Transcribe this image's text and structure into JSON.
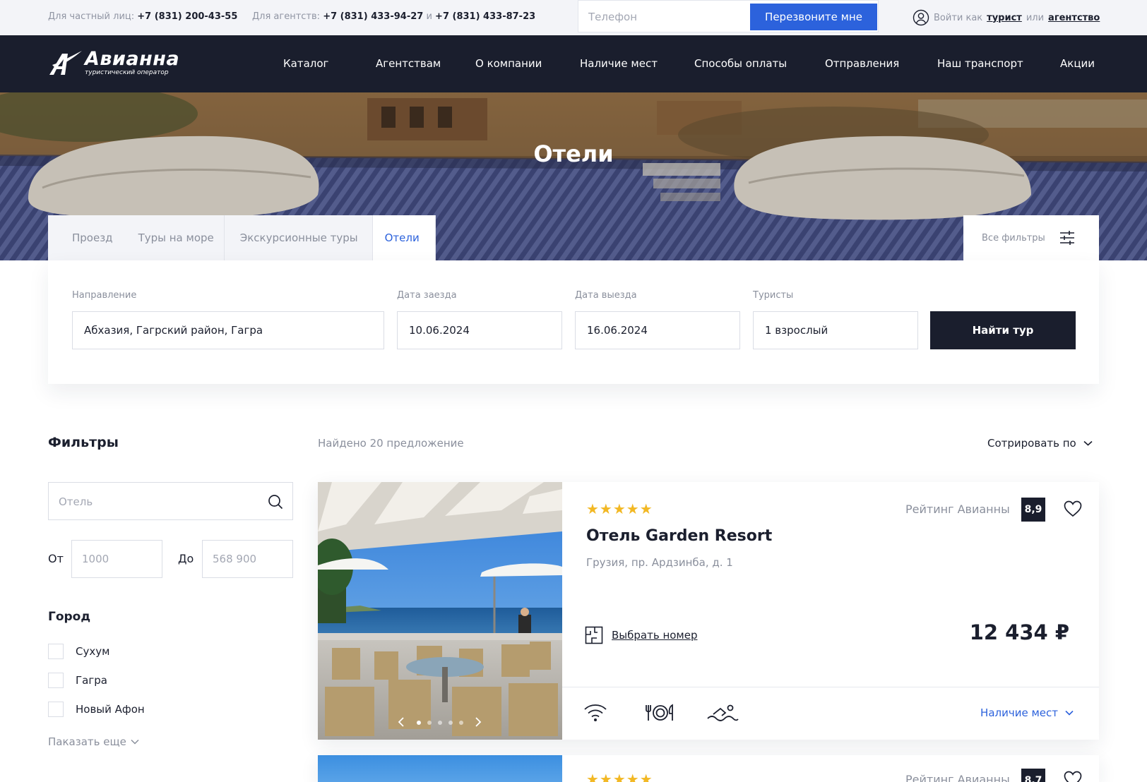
{
  "topbar": {
    "private_label": "Для частный лиц:",
    "private_phone": "+7 (831) 200-43-55",
    "agency_label": "Для агентств:",
    "agency_phone_1": "+7 (831) 433-94-27",
    "agency_and": "и",
    "agency_phone_2": "+7 (831) 433-87-23",
    "phone_placeholder": "Телефон",
    "callback_label": "Перезвоните мне",
    "login_prefix": "Войти как",
    "login_tourist": "турист",
    "login_or": "или",
    "login_agency": "агентство"
  },
  "brand": {
    "name": "Авианна",
    "tagline": "туристический оператор"
  },
  "nav": {
    "items": [
      "Каталог",
      "Агентствам",
      "О компании",
      "Наличие мест",
      "Способы оплаты",
      "Отправления",
      "Наш транспорт",
      "Акции"
    ]
  },
  "hero": {
    "title": "Отели"
  },
  "tabs": {
    "items": [
      "Проезд",
      "Туры на море",
      "Экскурсионные туры",
      "Отели"
    ],
    "active": "Отели",
    "all_filters": "Все фильтры"
  },
  "search": {
    "direction_label": "Направление",
    "direction_value": "Абхазия, Гагрский район, Гагра",
    "checkin_label": "Дата заезда",
    "checkin_value": "10.06.2024",
    "checkout_label": "Дата выезда",
    "checkout_value": "16.06.2024",
    "tourists_label": "Туристы",
    "tourists_value": "1 взрослый",
    "submit_label": "Найти тур"
  },
  "filters": {
    "title": "Фильтры",
    "hotel_placeholder": "Отель",
    "from_label": "От",
    "from_placeholder": "1000",
    "to_label": "До",
    "to_placeholder": "568 900",
    "city_title": "Город",
    "cities": [
      "Сухум",
      "Гагра",
      "Новый Афон"
    ],
    "show_more": "Паказать еще"
  },
  "results": {
    "found_text": "Найдено 20 предложение",
    "sort_label": "Сотрировать по",
    "cards": [
      {
        "stars": "★★★★★",
        "rating_label": "Рейтинг Авианны",
        "rating": "8,9",
        "name": "Отель Garden Resort",
        "address": "Грузия, пр. Ардзинба, д. 1",
        "choose_room": "Выбрать номер",
        "price": "12 434 ₽",
        "availability": "Наличие мест",
        "amenities": [
          "wifi-icon",
          "restaurant-icon",
          "pool-icon"
        ],
        "carousel_total": 5,
        "carousel_active": 1
      },
      {
        "stars": "★★★★★",
        "rating_label": "Рейтинг Авианны",
        "rating": "8,7"
      }
    ]
  },
  "colors": {
    "accent": "#2c62dc",
    "dark": "#1a1e2d",
    "star": "#f2b824",
    "muted": "#8a8f9c"
  }
}
